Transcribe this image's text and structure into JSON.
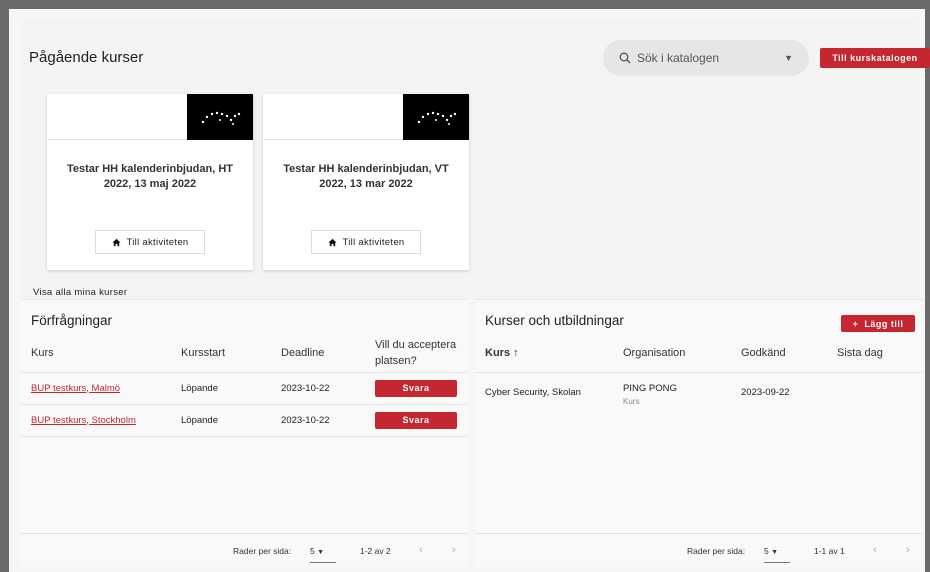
{
  "ongoing": {
    "title": "Pågående kurser",
    "search_placeholder": "Sök i katalogen",
    "catalog_button": "Till kurskatalogen",
    "cards": [
      {
        "title": "Testar HH kalenderinbjudan, HT 2022, 13 maj 2022",
        "button": "Till aktiviteten"
      },
      {
        "title": "Testar HH kalenderinbjudan, VT 2022, 13 mar 2022",
        "button": "Till aktiviteten"
      }
    ],
    "show_all": "Visa alla mina kurser"
  },
  "requests": {
    "title": "Förfrågningar",
    "columns": [
      "Kurs",
      "Kursstart",
      "Deadline",
      "Vill du acceptera platsen?"
    ],
    "rows": [
      {
        "course": "BUP testkurs, Malmö",
        "start": "Löpande",
        "deadline": "2023-10-22",
        "action": "Svara"
      },
      {
        "course": "BUP testkurs, Stockholm",
        "start": "Löpande",
        "deadline": "2023-10-22",
        "action": "Svara"
      }
    ],
    "pager": {
      "rows_label": "Rader per sida:",
      "rows_value": "5",
      "range": "1-2 av 2"
    }
  },
  "courses": {
    "title": "Kurser och utbildningar",
    "add_button": "Lägg till",
    "columns": [
      "Kurs",
      "Organisation",
      "Godkänd",
      "Sista dag"
    ],
    "sort_arrow": "↑",
    "rows": [
      {
        "course": "Cyber Security, Skolan",
        "org": "PING PONG",
        "org_type": "Kurs",
        "approved": "2023-09-22",
        "last_day": ""
      }
    ],
    "pager": {
      "rows_label": "Rader per sida:",
      "rows_value": "5",
      "range": "1-1 av 1"
    }
  },
  "colors": {
    "accent": "#c62630"
  }
}
